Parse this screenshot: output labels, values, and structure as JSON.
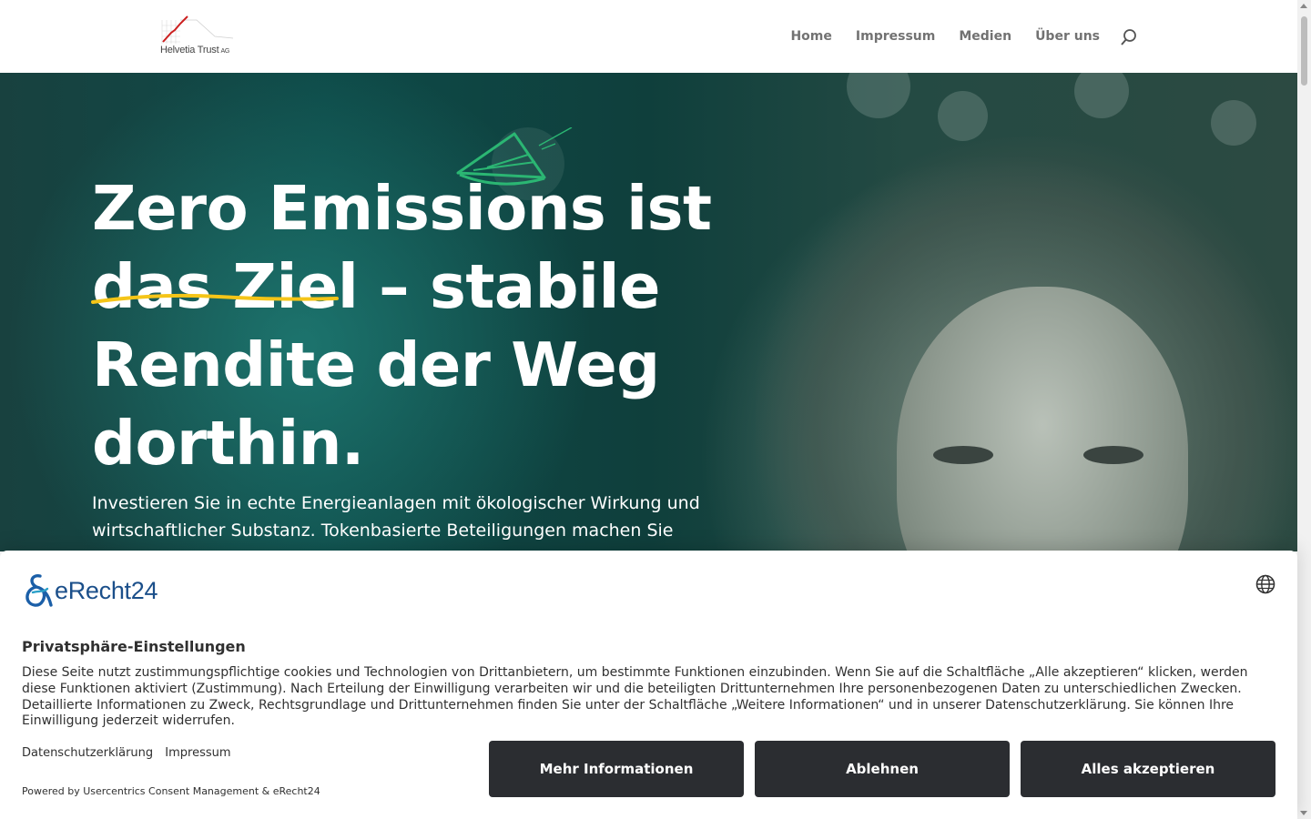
{
  "header": {
    "logo_text": "Helvetia Trust",
    "logo_suffix": "AG",
    "nav": [
      "Home",
      "Impressum",
      "Medien",
      "Über uns"
    ],
    "search_icon": "search-icon"
  },
  "hero": {
    "headline": "Zero Emissions ist das Ziel – stabile Rendite der Weg dorthin.",
    "subtext": "Investieren Sie in echte Energieanlagen mit ökologischer Wirkung und wirtschaftlicher Substanz. Tokenbasierte Beteiligungen machen Sie",
    "underline_color": "#f5c518",
    "plane_color": "#2bb673"
  },
  "consent": {
    "brand": "eRecht24",
    "globe_icon": "globe-icon",
    "title": "Privatsphäre-Einstellungen",
    "text": "Diese Seite nutzt zustimmungspflichtige cookies und Technologien von Drittanbietern, um bestimmte Funktionen einzubinden. Wenn Sie auf die Schaltfläche „Alle akzeptieren“ klicken, werden diese Funktionen aktiviert (Zustimmung). Nach Erteilung der Einwilligung verarbeiten wir und die beteiligten Drittunternehmen Ihre personenbezogenen Daten zu unterschiedlichen Zwecken. Detaillierte Informationen zu Zweck, Rechtsgrundlage und Drittunternehmen finden Sie unter der Schaltfläche „Weitere Informationen“ und in unserer Datenschutzerklärung. Sie können Ihre Einwilligung jederzeit widerrufen.",
    "link_privacy": "Datenschutzerklärung",
    "link_imprint": "Impressum",
    "powered": "Powered by Usercentrics Consent Management & eRecht24",
    "btn_more": "Mehr Informationen",
    "btn_decline": "Ablehnen",
    "btn_accept": "Alles akzeptieren",
    "button_color": "#2b2d31"
  }
}
